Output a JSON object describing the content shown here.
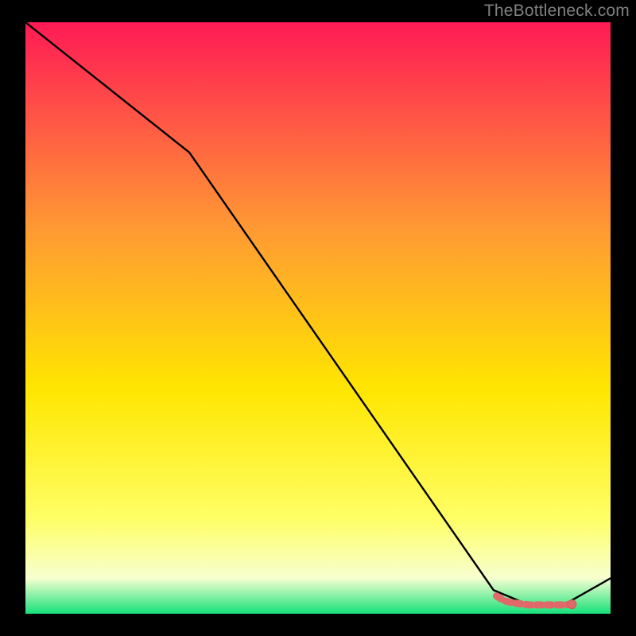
{
  "attribution": "TheBottleneck.com",
  "colors": {
    "gradient_top": "#ff1a55",
    "gradient_mid_upper": "#ff9a33",
    "gradient_mid": "#ffe600",
    "gradient_mid_lower": "#ffff66",
    "gradient_pale": "#f7ffd0",
    "gradient_bottom": "#16e07a",
    "line": "#000000",
    "marker_fill": "#e06a69",
    "marker_stroke": "#cf5a59"
  },
  "chart_data": {
    "type": "line",
    "title": "",
    "xlabel": "",
    "ylabel": "",
    "xlim": [
      0,
      100
    ],
    "ylim": [
      0,
      100
    ],
    "series": [
      {
        "name": "curve",
        "x": [
          0,
          28,
          80,
          86,
          92,
          100
        ],
        "y": [
          100,
          78,
          4,
          1.5,
          1.5,
          6
        ]
      }
    ],
    "markers": {
      "name": "flat-segment",
      "x": [
        80.5,
        81.8,
        82.6,
        83.6,
        84.4,
        85.2,
        86.0,
        87.2,
        88.2,
        89.2,
        90.2,
        91.2,
        92.2,
        93.4
      ],
      "y": [
        3.0,
        2.2,
        2.0,
        1.8,
        1.7,
        1.6,
        1.5,
        1.5,
        1.5,
        1.5,
        1.5,
        1.5,
        1.5,
        1.6
      ]
    },
    "end_marker": {
      "x": 93.4,
      "y": 1.6
    }
  }
}
